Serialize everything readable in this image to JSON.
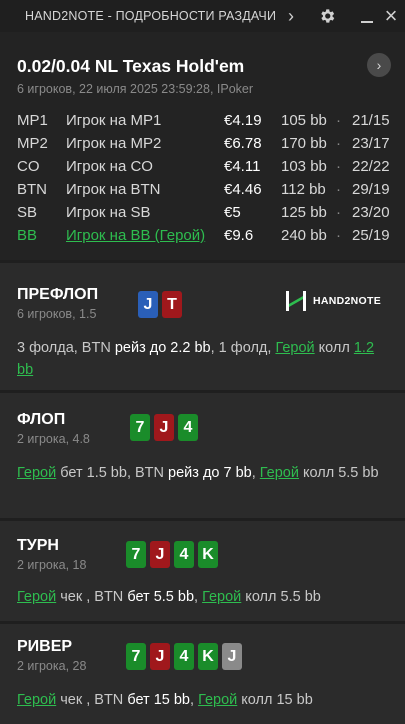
{
  "window": {
    "title": "HAND2NOTE - ПОДРОБНОСТИ РАЗДАЧИ",
    "chevron": "›",
    "close": "×"
  },
  "header": {
    "game": "0.02/0.04 NL Texas Hold'em",
    "details": "6 игроков, 22 июля 2025 23:59:28, IPoker",
    "nav_icon": "›"
  },
  "players": [
    {
      "pos": "MP1",
      "name": "Игрок на MP1",
      "stack": "€4.19",
      "bb": "105 bb",
      "dot": "·",
      "ratio": "21/15"
    },
    {
      "pos": "MP2",
      "name": "Игрок на MP2",
      "stack": "€6.78",
      "bb": "170 bb",
      "dot": "·",
      "ratio": "23/17"
    },
    {
      "pos": "CO",
      "name": "Игрок на CO",
      "stack": "€4.11",
      "bb": "103 bb",
      "dot": "·",
      "ratio": "22/22"
    },
    {
      "pos": "BTN",
      "name": "Игрок на BTN",
      "stack": "€4.46",
      "bb": "112 bb",
      "dot": "·",
      "ratio": "29/19"
    },
    {
      "pos": "SB",
      "name": "Игрок на SB",
      "stack": "€5",
      "bb": "125 bb",
      "dot": "·",
      "ratio": "23/20"
    },
    {
      "pos": "BB",
      "name": "Игрок на BB (Герой)",
      "stack": "€9.6",
      "bb": "240 bb",
      "dot": "·",
      "ratio": "25/19"
    }
  ],
  "logo": {
    "text": "HAND2NOTE"
  },
  "colors": {
    "hero": "#2ebd4f",
    "spade": "#2a5fb8",
    "heart": "#a0181c",
    "club": "#1a8c2a",
    "diamond": "#8a8a8a"
  },
  "streets": {
    "preflop": {
      "title": "ПРЕФЛОП",
      "sub": "6 игроков, 1.5",
      "cards": [
        {
          "rank": "J",
          "suit": "spade"
        },
        {
          "rank": "T",
          "suit": "heart"
        }
      ],
      "action": {
        "t1": "3 фолда, BTN ",
        "t2": "рейз до 2.2 bb",
        "t3": ", 1 фолд, ",
        "t4": "Герой",
        "t5": " колл ",
        "t6": "1.2 bb"
      }
    },
    "flop": {
      "title": "ФЛОП",
      "sub": "2 игрока, 4.8",
      "cards": [
        {
          "rank": "7",
          "suit": "club"
        },
        {
          "rank": "J",
          "suit": "heart"
        },
        {
          "rank": "4",
          "suit": "club"
        }
      ],
      "action": {
        "t1": "Герой",
        "t2": " бет ",
        "t3": "1.5 bb",
        "t4": ", BTN ",
        "t5": "рейз до 7 bb",
        "t6": ", ",
        "t7": "Герой",
        "t8": " колл ",
        "t9": "5.5 bb"
      }
    },
    "turn": {
      "title": "ТУРН",
      "sub": "2 игрока, 18",
      "cards": [
        {
          "rank": "7",
          "suit": "club"
        },
        {
          "rank": "J",
          "suit": "heart"
        },
        {
          "rank": "4",
          "suit": "club"
        },
        {
          "rank": "K",
          "suit": "club"
        }
      ],
      "action": {
        "t1": "Герой",
        "t2": " чек ",
        "t3": ", BTN ",
        "t4": "бет 5.5 bb",
        "t5": ", ",
        "t6": "Герой",
        "t7": " колл ",
        "t8": "5.5 bb"
      }
    },
    "river": {
      "title": "РИВЕР",
      "sub": "2 игрока, 28",
      "cards": [
        {
          "rank": "7",
          "suit": "club"
        },
        {
          "rank": "J",
          "suit": "heart"
        },
        {
          "rank": "4",
          "suit": "club"
        },
        {
          "rank": "K",
          "suit": "club"
        },
        {
          "rank": "J",
          "suit": "diamond"
        }
      ],
      "action": {
        "t1": "Герой",
        "t2": " чек ",
        "t3": ", BTN ",
        "t4": "бет 15 bb",
        "t5": ", ",
        "t6": "Герой",
        "t7": " колл ",
        "t8": "15 bb"
      }
    }
  }
}
